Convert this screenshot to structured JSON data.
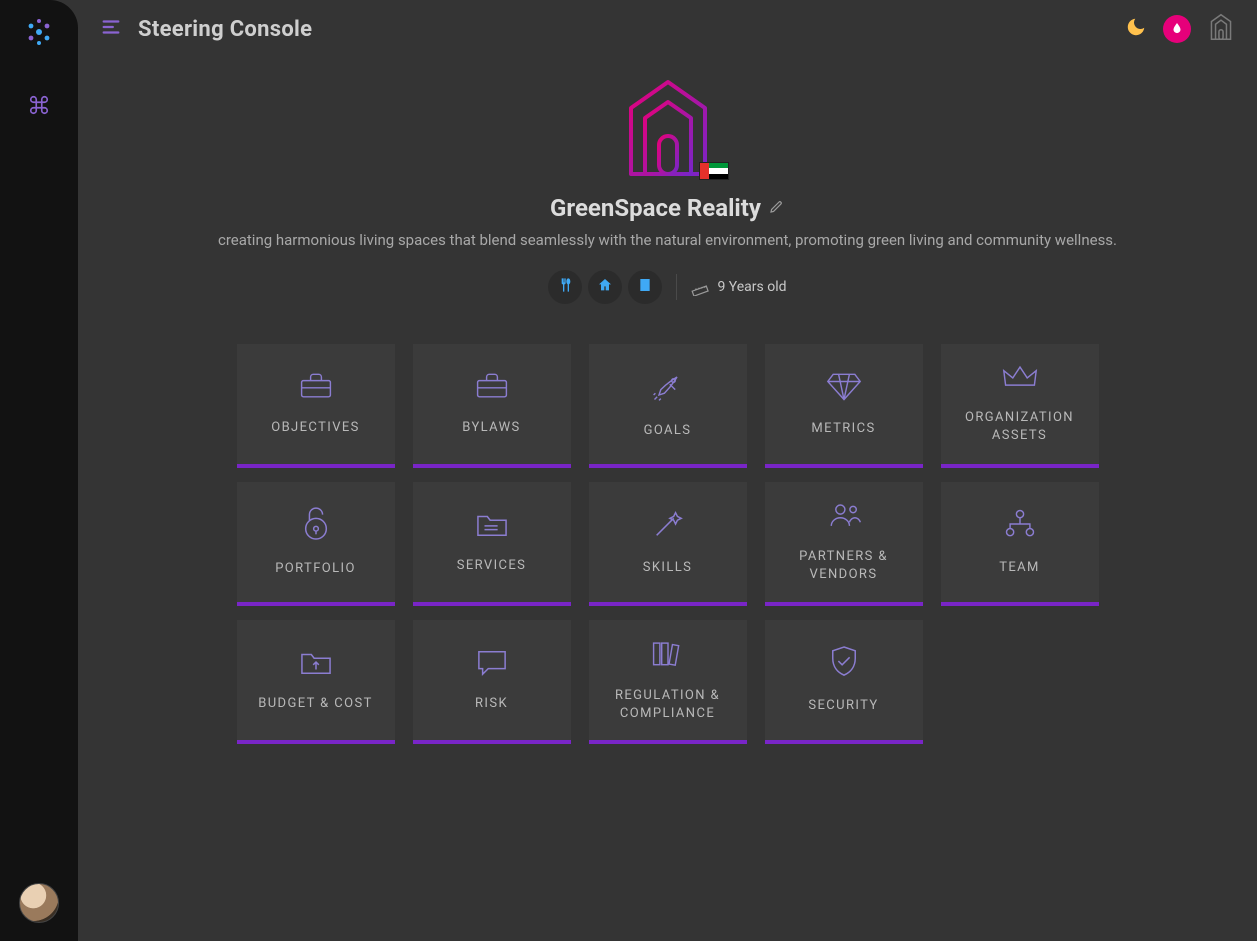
{
  "header": {
    "title": "Steering Console"
  },
  "org": {
    "name": "GreenSpace Reality",
    "description": "creating harmonious living spaces that blend seamlessly with the natural environment, promoting green living and community wellness.",
    "age_label": "9 Years old",
    "country_flag": "UAE"
  },
  "chips": [
    {
      "icon": "utensils"
    },
    {
      "icon": "home"
    },
    {
      "icon": "building"
    }
  ],
  "tiles": [
    {
      "label": "OBJECTIVES",
      "icon": "briefcase"
    },
    {
      "label": "BYLAWS",
      "icon": "briefcase"
    },
    {
      "label": "GOALS",
      "icon": "rocket"
    },
    {
      "label": "METRICS",
      "icon": "diamond"
    },
    {
      "label": "ORGANIZATION ASSETS",
      "icon": "crown"
    },
    {
      "label": "PORTFOLIO",
      "icon": "unlock"
    },
    {
      "label": "SERVICES",
      "icon": "folder-doc"
    },
    {
      "label": "SKILLS",
      "icon": "wand"
    },
    {
      "label": "PARTNERS & VENDORS",
      "icon": "people"
    },
    {
      "label": "TEAM",
      "icon": "org-chart"
    },
    {
      "label": "BUDGET & COST",
      "icon": "folder-up"
    },
    {
      "label": "RISK",
      "icon": "chat"
    },
    {
      "label": "REGULATION & COMPLIANCE",
      "icon": "books"
    },
    {
      "label": "SECURITY",
      "icon": "shield-check"
    }
  ],
  "colors": {
    "accent_purple": "#7925c7",
    "icon_purple": "#8b7dd1",
    "pink": "#e6007a",
    "moon": "#ffc14d",
    "chip_blue": "#3fa9f5"
  }
}
